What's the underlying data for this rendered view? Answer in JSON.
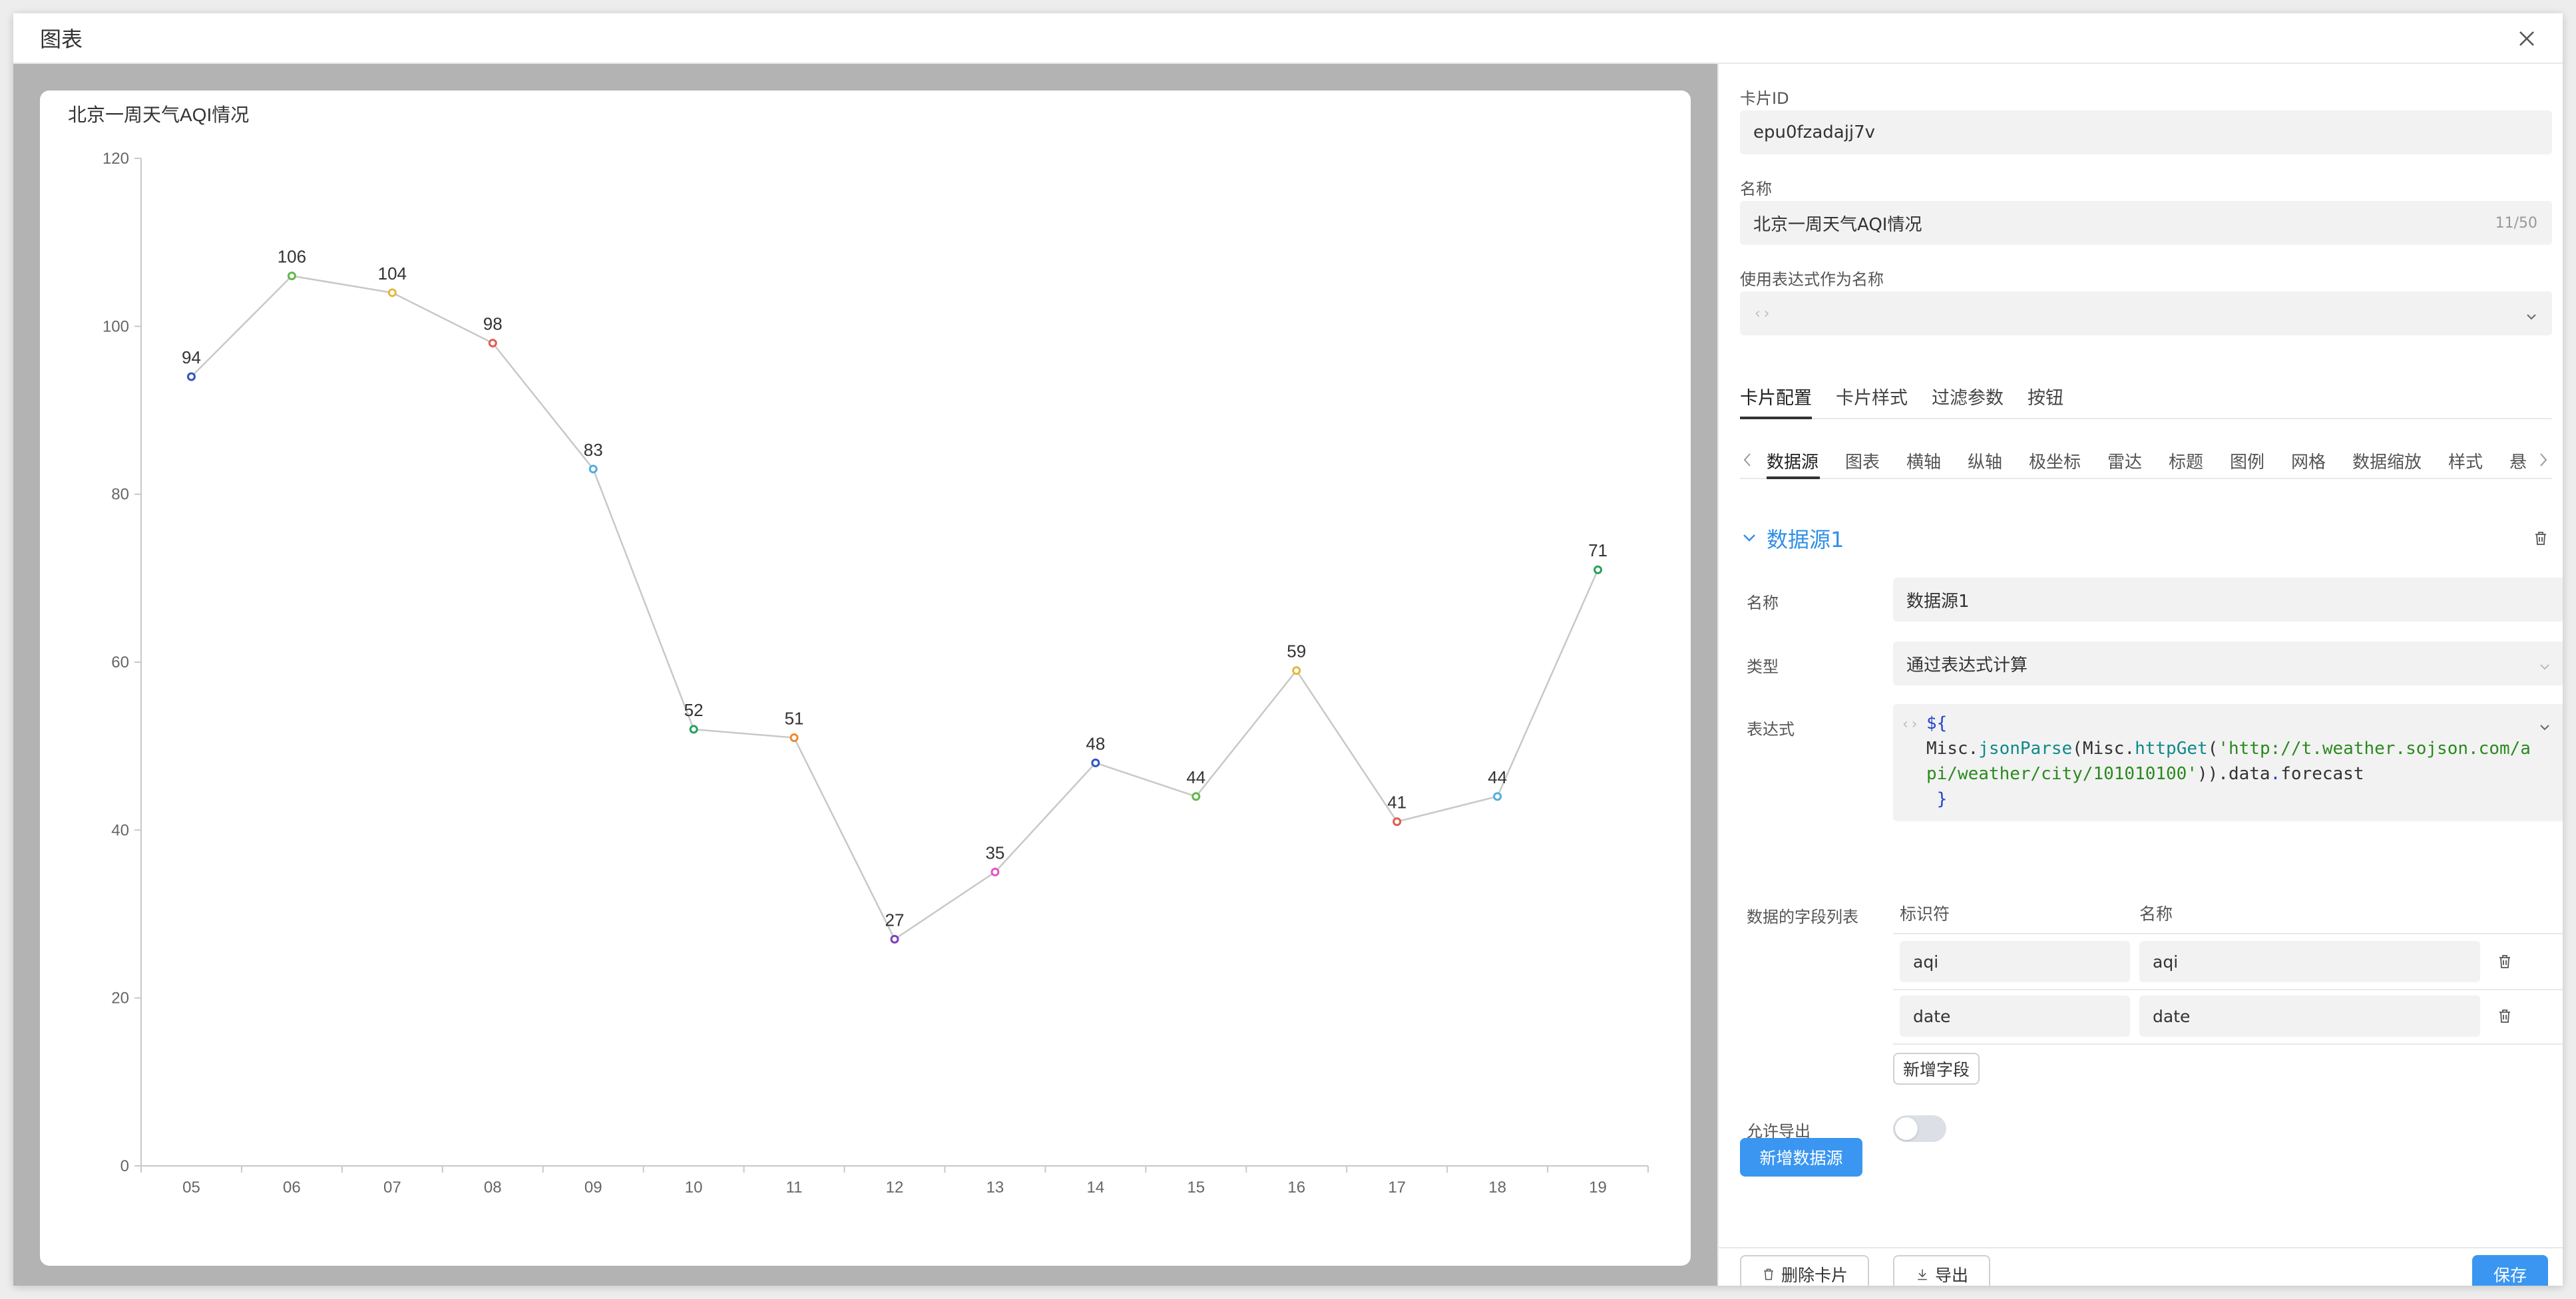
{
  "modal": {
    "title": "图表"
  },
  "chart_data": {
    "type": "line",
    "title": "北京一周天气AQI情况",
    "categories": [
      "05",
      "06",
      "07",
      "08",
      "09",
      "10",
      "11",
      "12",
      "13",
      "14",
      "15",
      "16",
      "17",
      "18",
      "19"
    ],
    "values": [
      94,
      106,
      104,
      98,
      83,
      52,
      51,
      27,
      35,
      48,
      44,
      59,
      41,
      44,
      71
    ],
    "point_colors": [
      "#2f56c0",
      "#5fb94a",
      "#e6b73a",
      "#e35a4f",
      "#52aee0",
      "#26a05f",
      "#ed8a2f",
      "#7b3fc0",
      "#e356c6",
      "#2f56c0",
      "#5fb94a",
      "#e6b73a",
      "#e35a4f",
      "#52aee0",
      "#26a05f"
    ],
    "ylim": [
      0,
      120
    ],
    "yticks": [
      "0",
      "20",
      "40",
      "60",
      "80",
      "100",
      "120"
    ],
    "line_color": "#c8c8c8",
    "grid": false
  },
  "panel": {
    "card_id": {
      "label": "卡片ID",
      "value": "epu0fzadajj7v"
    },
    "name": {
      "label": "名称",
      "value": "北京一周天气AQI情况",
      "counter": "11/50"
    },
    "expr_name": {
      "label": "使用表达式作为名称",
      "code_mark": "‹›"
    },
    "tabs": [
      {
        "label": "卡片配置"
      },
      {
        "label": "卡片样式"
      },
      {
        "label": "过滤参数"
      },
      {
        "label": "按钮"
      }
    ],
    "subtabs": [
      {
        "label": "数据源"
      },
      {
        "label": "图表"
      },
      {
        "label": "横轴"
      },
      {
        "label": "纵轴"
      },
      {
        "label": "极坐标"
      },
      {
        "label": "雷达"
      },
      {
        "label": "标题"
      },
      {
        "label": "图例"
      },
      {
        "label": "网格"
      },
      {
        "label": "数据缩放"
      },
      {
        "label": "样式"
      },
      {
        "label": "悬"
      }
    ],
    "datasource": {
      "title": "数据源1",
      "name_label": "名称",
      "name_value": "数据源1",
      "type_label": "类型",
      "type_value": "通过表达式计算",
      "expr_label": "表达式",
      "code_mark": "‹›",
      "code_lines": {
        "l1a": "${",
        "l2a": "Misc.",
        "l2b": "jsonParse",
        "l2c": "(Misc.",
        "l2d": "httpGet",
        "l2e": "(",
        "l2f": "'http://t.weather.sojson.com/a",
        "l3a": "pi/weather/city/101010100'",
        "l3b": ")).",
        "l3c": "data",
        "l3d": ".",
        "l3e": "forecast",
        "l4a": "}"
      },
      "fields_label": "数据的字段列表",
      "col_id": "标识符",
      "col_name": "名称",
      "fields": [
        {
          "id": "aqi",
          "name": "aqi"
        },
        {
          "id": "date",
          "name": "date"
        }
      ],
      "add_field": "新增字段",
      "export_label": "允许导出",
      "export_enabled": false
    },
    "add_datasource": "新增数据源",
    "footer": {
      "delete": "删除卡片",
      "export": "导出",
      "save": "保存"
    },
    "accent": "#3a96f0"
  }
}
